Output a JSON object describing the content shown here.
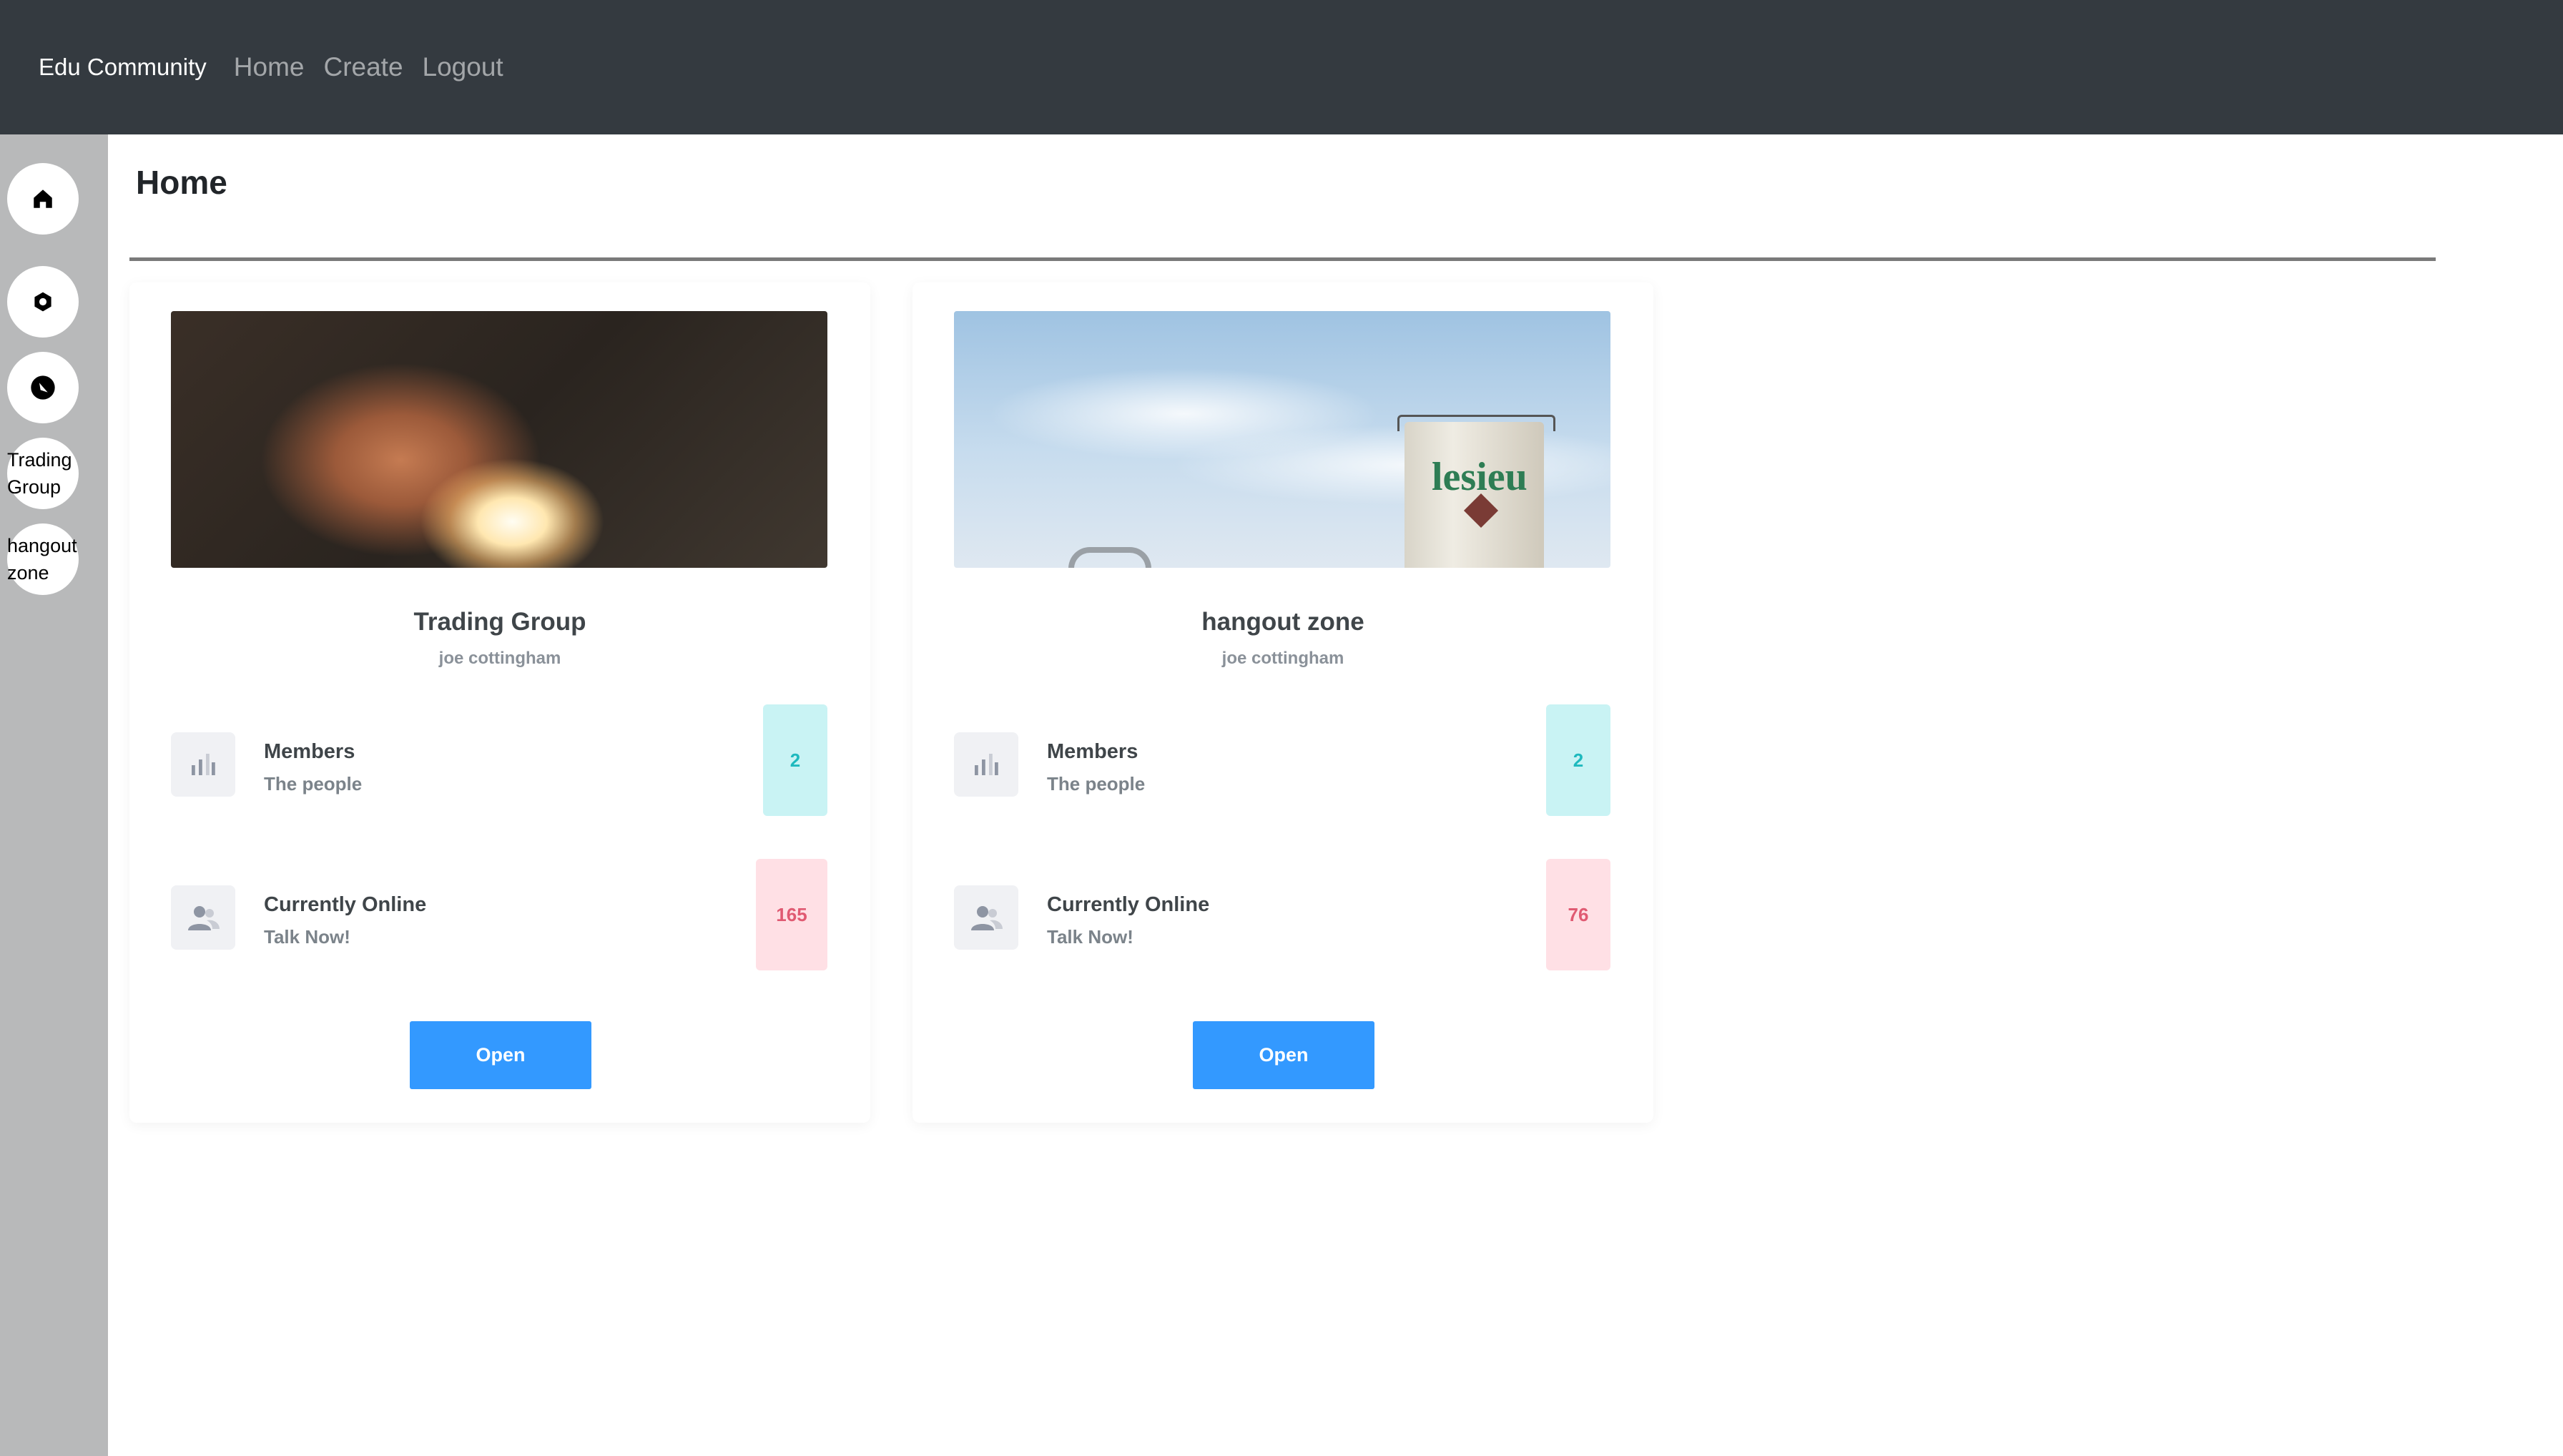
{
  "navbar": {
    "brand": "Edu Community",
    "links": [
      "Home",
      "Create",
      "Logout"
    ]
  },
  "sidebar": {
    "items": [
      {
        "icon": "home-icon"
      },
      {
        "icon": "gear-icon"
      },
      {
        "icon": "compass-icon"
      },
      {
        "label": "Trading Group"
      },
      {
        "label": "hangout zone"
      }
    ]
  },
  "main": {
    "title": "Home",
    "cards": [
      {
        "title": "Trading Group",
        "owner": "joe cottingham",
        "members_title": "Members",
        "members_sub": "The people",
        "members_count": "2",
        "online_title": "Currently Online",
        "online_sub": "Talk Now!",
        "online_count": "165",
        "button": "Open"
      },
      {
        "title": "hangout zone",
        "owner": "joe cottingham",
        "members_title": "Members",
        "members_sub": "The people",
        "members_count": "2",
        "online_title": "Currently Online",
        "online_sub": "Talk Now!",
        "online_count": "76",
        "button": "Open",
        "image_text": "lesieu"
      }
    ]
  },
  "colors": {
    "navbar": "#343a40",
    "sidebar": "#b8b9ba",
    "primary_button": "#3399ff",
    "members_badge": "#c9f3f4",
    "online_badge": "#ffe0e5"
  }
}
